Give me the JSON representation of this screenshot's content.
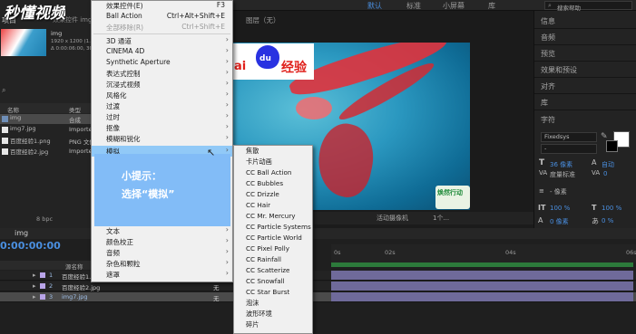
{
  "brand": {
    "text": "秒懂视频"
  },
  "top_right_tabs": [
    "默认",
    "标准",
    "小屏幕",
    "库"
  ],
  "search": {
    "placeholder": "搜索帮助"
  },
  "project": {
    "tab": "项目",
    "effects_tab": "效果控件 img",
    "item_name": "img",
    "item_info": "1920 x 1200 (1.00)",
    "item_duration": "Δ 0:00:06:00, 30.00",
    "columns": [
      "名称",
      "类型"
    ],
    "rows": [
      {
        "name": "img",
        "type": "合成"
      },
      {
        "name": "img7.jpg",
        "type": "Importer"
      },
      {
        "name": "百度经验1.png",
        "type": "PNG 文件"
      },
      {
        "name": "百度经验2.jpg",
        "type": "Importer"
      }
    ],
    "bpc": "8 bpc"
  },
  "viewer": {
    "tab_label": "图层（无）",
    "camera": "活动摄像机",
    "views": "1个..."
  },
  "composition_image": {
    "logo_left": "ai",
    "logo_du": "du",
    "logo_right": "经验",
    "badge": "焕然行动"
  },
  "right_panel": {
    "items": [
      "信息",
      "音频",
      "预览",
      "效果和预设",
      "对齐",
      "库"
    ],
    "character_title": "字符",
    "font": "Fixedsys",
    "style": "-",
    "size": "36 像素",
    "leading": "自动",
    "tracking_label": "度量标准",
    "tracking_val": "0",
    "stroke_width": "- 像素",
    "scale_v": "100 %",
    "scale_h": "100 %",
    "baseline": "0 像素",
    "tsume": "0 %"
  },
  "menu": {
    "items": [
      {
        "label": "效果控件(E)",
        "shortcut": "F3"
      },
      {
        "label": "Ball Action",
        "shortcut": "Ctrl+Alt+Shift+E"
      },
      {
        "label": "全部移除(R)",
        "shortcut": "Ctrl+Shift+E",
        "disabled": true
      },
      {
        "label": "3D 通道",
        "arrow": "›"
      },
      {
        "label": "CINEMA 4D",
        "arrow": "›"
      },
      {
        "label": "Synthetic Aperture",
        "arrow": "›"
      },
      {
        "label": "表达式控制",
        "arrow": "›"
      },
      {
        "label": "沉浸式视频",
        "arrow": "›"
      },
      {
        "label": "风格化",
        "arrow": "›"
      },
      {
        "label": "过渡",
        "arrow": "›"
      },
      {
        "label": "过时",
        "arrow": "›"
      },
      {
        "label": "抠像",
        "arrow": "›"
      },
      {
        "label": "模糊和锐化",
        "arrow": "›"
      },
      {
        "label": "模拟",
        "arrow": "›"
      },
      {
        "label": "文本",
        "arrow": "›"
      },
      {
        "label": "颜色校正",
        "arrow": "›"
      },
      {
        "label": "音频",
        "arrow": "›"
      },
      {
        "label": "杂色和颗粒",
        "arrow": "›"
      },
      {
        "label": "遮罩",
        "arrow": "›"
      }
    ]
  },
  "tip": {
    "title": "小提示：",
    "body": "选择“模拟”"
  },
  "submenu": {
    "items": [
      "焦散",
      "卡片动画",
      "CC Ball Action",
      "CC Bubbles",
      "CC Drizzle",
      "CC Hair",
      "CC Mr. Mercury",
      "CC Particle Systems II",
      "CC Particle World",
      "CC Pixel Polly",
      "CC Rainfall",
      "CC Scatterize",
      "CC Snowfall",
      "CC Star Burst",
      "泡沫",
      "波形环境",
      "碎片"
    ]
  },
  "timeline": {
    "tab": "img",
    "timecode": "0:00:00:00",
    "ruler": [
      "0s",
      "02s",
      "04s",
      "06s"
    ],
    "layers": [
      {
        "num": "1",
        "name": "百度经验1.png",
        "parent": "无"
      },
      {
        "num": "2",
        "name": "百度经验2.jpg",
        "parent": "无"
      },
      {
        "num": "3",
        "name": "img7.jpg",
        "parent": "无"
      }
    ],
    "col_source": "源名称"
  }
}
